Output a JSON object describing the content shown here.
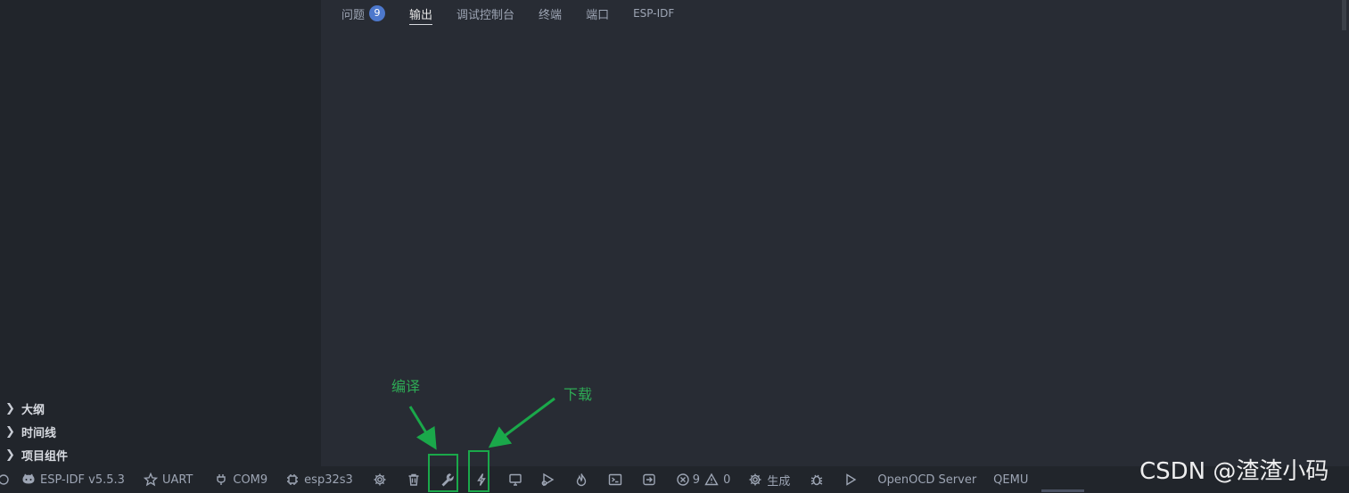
{
  "panel": {
    "tabs": [
      {
        "label": "问题",
        "badge": "9"
      },
      {
        "label": "输出"
      },
      {
        "label": "调试控制台"
      },
      {
        "label": "终端"
      },
      {
        "label": "端口"
      },
      {
        "label": "ESP-IDF"
      }
    ],
    "active_tab": "输出"
  },
  "tree": {
    "items": [
      {
        "label": "大纲"
      },
      {
        "label": "时间线"
      },
      {
        "label": "项目组件"
      }
    ]
  },
  "statusbar": {
    "idf_version": "ESP-IDF v5.5.3",
    "flash_method": "UART",
    "port": "COM9",
    "target": "esp32s3",
    "errors": "9",
    "warnings": "0",
    "build_label": "生成",
    "openocd": "OpenOCD Server",
    "qemu": "QEMU"
  },
  "annotations": {
    "build": "编译",
    "flash": "下载"
  },
  "watermark": "CSDN @渣渣小码",
  "colors": {
    "highlight": "#1aa84a",
    "annotation_text": "#2eaa55",
    "badge": "#4d78cc"
  }
}
